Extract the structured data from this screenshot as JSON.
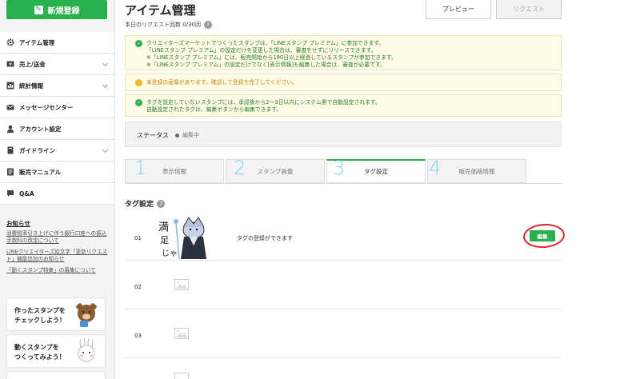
{
  "sidebar": {
    "new_button": "新規登録",
    "items": [
      {
        "label": "アイテム管理",
        "icon": "gear-icon",
        "has_chevron": false
      },
      {
        "label": "売上/送金",
        "icon": "yen-icon",
        "has_chevron": true
      },
      {
        "label": "統計情報",
        "icon": "chart-icon",
        "has_chevron": true
      },
      {
        "label": "メッセージセンター",
        "icon": "mail-icon",
        "has_chevron": false
      },
      {
        "label": "アカウント設定",
        "icon": "user-icon",
        "has_chevron": false
      },
      {
        "label": "ガイドライン",
        "icon": "book-icon",
        "has_chevron": true
      },
      {
        "label": "販売マニュアル",
        "icon": "manual-icon",
        "has_chevron": false
      },
      {
        "label": "Q&A",
        "icon": "question-icon",
        "has_chevron": false
      }
    ],
    "notice_title": "お知らせ",
    "notices": [
      "消費税率引き上げに伴う銀行口座への振込手数料の改定について",
      "LINEクリエイターズ絵文字「更新リクエスト」機能追加のお知らせ",
      "「動くスタンプ特集」の募集について"
    ],
    "promos": [
      {
        "line1": "作ったスタンプを",
        "line2": "チェックしよう！"
      },
      {
        "line1": "動くスタンプを",
        "line2": "つくってみよう！"
      }
    ]
  },
  "main": {
    "title": "アイテム管理",
    "request_count": "本日のリクエスト回数 0/30回",
    "preview_button": "プレビュー",
    "request_button": "リクエスト",
    "alerts": {
      "premium_lines": [
        "クリエイターズマーケットでつくったスタンプは、「LINEスタンプ プレミアム」に参加できます。",
        "「LINEスタンプ プレミアム」の設定だけを変更した場合は、審査をせずにリリースできます。",
        "※「LINEスタンプ プレミアム」には、販売開始から180日以上経過しているスタンプが参加できます。",
        "※「LINEスタンプ プレミアム」の設定だけでなく[表示情報]も編集した場合は、審査が必要です。"
      ],
      "warning": "未登録の画像があります。確認して登録を完了してください。",
      "tag_lines": [
        "タグを設定していないスタンプには、承認後から2〜3日以内にシステム側で自動設定されます。",
        "自動設定されたタグは、編集ボタンから編集できます。"
      ]
    },
    "status_label": "ステータス",
    "status_value": "編集中",
    "tabs": [
      {
        "label": "表示情報",
        "step": "1",
        "active": false
      },
      {
        "label": "スタンプ画像",
        "step": "2",
        "active": false
      },
      {
        "label": "タグ設定",
        "step": "3",
        "active": true
      },
      {
        "label": "販売価格情報",
        "step": "4",
        "active": false
      }
    ],
    "tag_section_title": "タグ設定",
    "rows": [
      {
        "num": "01",
        "text": "タグの登録ができます",
        "has_sticker": true
      },
      {
        "num": "02",
        "text": "",
        "has_sticker": false
      },
      {
        "num": "03",
        "text": "",
        "has_sticker": false
      }
    ],
    "edit_button": "編集",
    "sticker_text": "満足じゃ"
  },
  "colors": {
    "brand_green": "#27b04b",
    "alert_green_text": "#2a7d2e",
    "warning_orange": "#f2b51a",
    "annotation_blue": "#7fd4ec",
    "annotation_red": "#d8262b"
  }
}
